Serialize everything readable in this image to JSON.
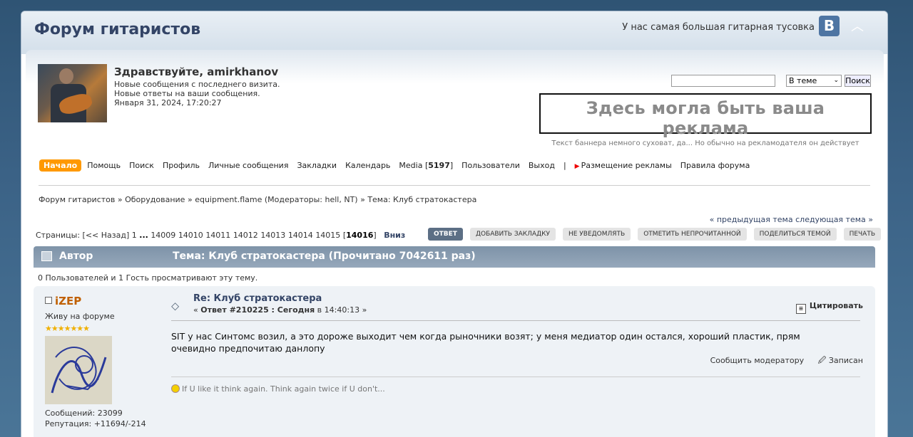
{
  "header": {
    "forum_title": "Форум гитаристов",
    "slogan": "У нас самая большая гитарная тусовка",
    "vk_label": "В"
  },
  "user": {
    "greeting": "Здравствуйте, amirkhanov",
    "new_since_visit": "Новые сообщения с последнего визита.",
    "new_replies": "Новые ответы на ваши сообщения.",
    "datetime": "Января 31, 2024, 17:20:27"
  },
  "search": {
    "input_value": "",
    "scope_selected": "В теме",
    "button_label": "Поиск"
  },
  "banner": {
    "headline": "Здесь могла быть ваша реклама",
    "subtext": "Текст баннера немного суховат, да... Но обычно на рекламодателя он действует"
  },
  "menu": {
    "items": [
      "Начало",
      "Помощь",
      "Поиск",
      "Профиль",
      "Личные сообщения",
      "Закладки",
      "Календарь"
    ],
    "media_label": "Media [",
    "media_count": "5197",
    "media_close": "]",
    "users": "Пользователи",
    "logout": "Выход",
    "separator": "|",
    "ads": "Размещение рекламы",
    "rules": "Правила форума"
  },
  "breadcrumb": {
    "items": [
      "Форум гитаристов",
      "Оборудование",
      "equipment.flame"
    ],
    "moderators": "(Модераторы: hell, NT)",
    "topic": "Тема: Клуб стратокастера",
    "sep": "»"
  },
  "topic_nav": {
    "prev": "« предыдущая тема",
    "next": "следующая тема »"
  },
  "pagination": {
    "label": "Страницы:",
    "back": "[<< Назад]",
    "first": "1",
    "ellipsis": "...",
    "pages": [
      "14009",
      "14010",
      "14011",
      "14012",
      "14013",
      "14014",
      "14015"
    ],
    "current": "14016",
    "down": "Вниз"
  },
  "actions": {
    "reply": "ОТВЕТ",
    "bookmark": "ДОБАВИТЬ ЗАКЛАДКУ",
    "no_notify": "НЕ УВЕДОМЛЯТЬ",
    "mark_unread": "ОТМЕТИТЬ НЕПРОЧИТАННОЙ",
    "share": "ПОДЕЛИТЬСЯ ТЕМОЙ",
    "print": "ПЕЧАТЬ"
  },
  "topic_header": {
    "author_label": "Автор",
    "title": "Тема: Клуб стратокастера  (Прочитано 7042611 раз)"
  },
  "viewers": "0 Пользователей и 1 Гость просматривают эту тему.",
  "post": {
    "poster_name": "iZEP",
    "poster_title": "Живу на форуме",
    "stars": "★★★★★★★",
    "messages": "Сообщений: 23099",
    "reputation": "Репутация: +11694/-214",
    "subject": "Re: Клуб стратокастера",
    "meta_prefix": "« ",
    "meta_reply": "Ответ #210225 : ",
    "meta_today": "Сегодня",
    "meta_time": " в 14:40:13 »",
    "quote": "Цитировать",
    "text": "SIT у нас Синтомс возил, а это дороже выходит чем когда рыночники возят; у меня медиатор один остался, хороший пластик, прям очевидно предпочитаю данлопу",
    "report": "Сообщить модератору",
    "logged": "Записан",
    "signature": "If U like it think again. Think again twice if U don't..."
  }
}
